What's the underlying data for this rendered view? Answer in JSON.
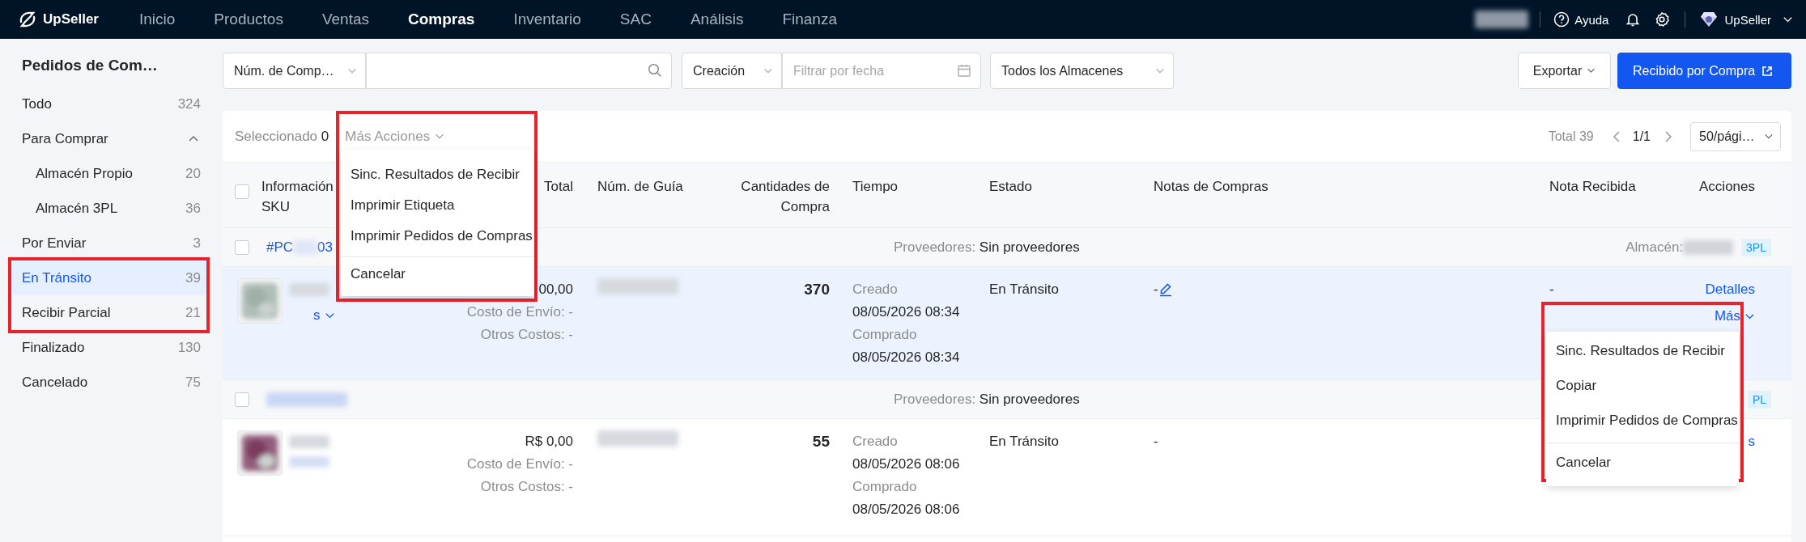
{
  "top_nav": {
    "brand": "UpSeller",
    "items": [
      {
        "label": "Inicio",
        "selected": false
      },
      {
        "label": "Productos",
        "selected": false
      },
      {
        "label": "Ventas",
        "selected": false
      },
      {
        "label": "Compras",
        "selected": true
      },
      {
        "label": "Inventario",
        "selected": false
      },
      {
        "label": "SAC",
        "selected": false
      },
      {
        "label": "Análisis",
        "selected": false
      },
      {
        "label": "Finanza",
        "selected": false
      }
    ],
    "help": "Ayuda",
    "account": "UpSeller"
  },
  "sidebar": {
    "title": "Pedidos de Com…",
    "items": [
      {
        "label": "Todo",
        "count": "324",
        "selected": false,
        "highlighted": false
      },
      {
        "label": "Para Comprar",
        "selected": false,
        "highlighted": false,
        "expanded": true,
        "children": [
          {
            "label": "Almacén Propio",
            "count": "20",
            "selected": false
          },
          {
            "label": "Almacén 3PL",
            "count": "36",
            "selected": false
          }
        ]
      },
      {
        "label": "Por Enviar",
        "count": "3",
        "selected": false,
        "highlighted": false
      },
      {
        "label": "En Tránsito",
        "count": "39",
        "selected": true,
        "highlighted": true
      },
      {
        "label": "Recibir Parcial",
        "count": "21",
        "selected": false,
        "highlighted": true
      },
      {
        "label": "Finalizado",
        "count": "130",
        "selected": false,
        "highlighted": false
      },
      {
        "label": "Cancelado",
        "count": "75",
        "selected": false,
        "highlighted": false
      }
    ]
  },
  "filters": {
    "search_type": "Núm. de Comp…",
    "date_type": "Creación",
    "date": {
      "placeholder": "Filtrar por fecha"
    },
    "warehouse": "Todos los Almacenes",
    "export": "Exportar",
    "primary_action": "Recibido por Compra"
  },
  "toolbar": {
    "selected_label": "Seleccionado",
    "selected_count": "0",
    "more_actions": "Más Acciones",
    "total": "Total 39",
    "page": "1/1",
    "page_size": "50/pági…"
  },
  "bulk_menu": {
    "highlighted": true,
    "sections": [
      [
        "Sinc. Resultados de Recibir",
        "Imprimir Etiqueta",
        "Imprimir Pedidos de Compras"
      ],
      [
        "Cancelar"
      ]
    ]
  },
  "table": {
    "select_all": {
      "checked": false
    },
    "columns": [
      {
        "label": "Información SKU"
      },
      {
        "label": "Total"
      },
      {
        "label": "Núm. de Guía"
      },
      {
        "label": "Cantidades de Compra"
      },
      {
        "label": "Tiempo"
      },
      {
        "label": "Estado"
      },
      {
        "label": "Notas de Compras"
      },
      {
        "label": "Nota Recibida"
      },
      {
        "label": "Acciones"
      }
    ],
    "groups": [
      {
        "checked": false,
        "order_start": "#PC",
        "order_end": "03",
        "supplier_label": "Proveedores:",
        "supplier": "Sin proveedores",
        "warehouse_label": "Almacén:",
        "tag": "3PL",
        "rows": [
          {
            "hovered": true,
            "sku_link": "s",
            "price": "00,00",
            "shipping": "Costo de Envío: -",
            "other_costs": "Otros Costos: -",
            "quantity": "370",
            "created_label": "Creado",
            "created": "08/05/2026 08:34",
            "purchased_label": "Comprado",
            "purchased": "08/05/2026 08:34",
            "status": "En Tránsito",
            "notes": "-",
            "notes_editable": true,
            "received_note": "-",
            "actions": [
              {
                "label": "Detalles",
                "kind": "link"
              },
              {
                "label": "Más",
                "kind": "dropdown"
              }
            ]
          }
        ]
      },
      {
        "checked": false,
        "supplier_label": "Proveedores:",
        "supplier": "Sin proveedores",
        "tag": "PL",
        "rows": [
          {
            "hovered": false,
            "price": "R$ 0,00",
            "shipping": "Costo de Envío: -",
            "other_costs": "Otros Costos: -",
            "quantity": "55",
            "created_label": "Creado",
            "created": "08/05/2026 08:06",
            "purchased_label": "Comprado",
            "purchased": "08/05/2026 08:06",
            "status": "En Tránsito",
            "notes": "-",
            "notes_editable": false,
            "actions": [
              {
                "label": "s",
                "kind": "link"
              }
            ]
          }
        ]
      }
    ]
  },
  "row_menu": {
    "highlighted": true,
    "sections": [
      [
        "Sinc. Resultados de Recibir",
        "Copiar",
        "Imprimir Pedidos de Compras"
      ],
      [
        "Cancelar"
      ]
    ]
  }
}
